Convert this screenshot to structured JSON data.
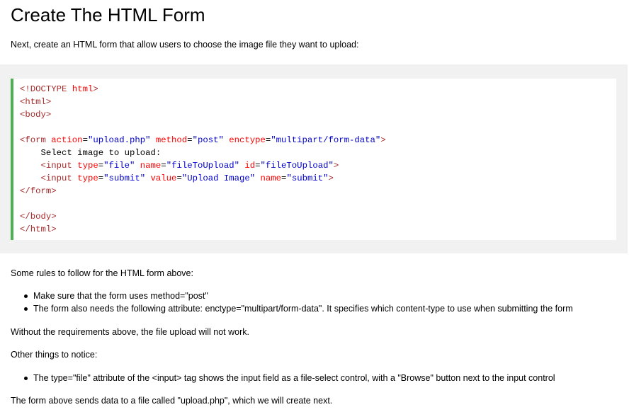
{
  "heading": "Create The HTML Form",
  "intro": "Next, create an HTML form that allow users to choose the image file they want to upload:",
  "code_lines": [
    [
      {
        "t": "<",
        "c": "tag"
      },
      {
        "t": "!DOCTYPE",
        "c": "tag"
      },
      {
        "t": " html",
        "c": "attr"
      },
      {
        "t": ">",
        "c": "tag"
      }
    ],
    [
      {
        "t": "<html>",
        "c": "tag"
      }
    ],
    [
      {
        "t": "<body>",
        "c": "tag"
      }
    ],
    [],
    [
      {
        "t": "<form",
        "c": "tag"
      },
      {
        "t": " action",
        "c": "attr"
      },
      {
        "t": "=",
        "c": "text"
      },
      {
        "t": "\"upload.php\"",
        "c": "val"
      },
      {
        "t": " method",
        "c": "attr"
      },
      {
        "t": "=",
        "c": "text"
      },
      {
        "t": "\"post\"",
        "c": "val"
      },
      {
        "t": " enctype",
        "c": "attr"
      },
      {
        "t": "=",
        "c": "text"
      },
      {
        "t": "\"multipart/form-data\"",
        "c": "val"
      },
      {
        "t": ">",
        "c": "tag"
      }
    ],
    [
      {
        "t": "    Select image to upload:",
        "c": "text"
      }
    ],
    [
      {
        "t": "    ",
        "c": "text"
      },
      {
        "t": "<input",
        "c": "tag"
      },
      {
        "t": " type",
        "c": "attr"
      },
      {
        "t": "=",
        "c": "text"
      },
      {
        "t": "\"file\"",
        "c": "val"
      },
      {
        "t": " name",
        "c": "attr"
      },
      {
        "t": "=",
        "c": "text"
      },
      {
        "t": "\"fileToUpload\"",
        "c": "val"
      },
      {
        "t": " id",
        "c": "attr"
      },
      {
        "t": "=",
        "c": "text"
      },
      {
        "t": "\"fileToUpload\"",
        "c": "val"
      },
      {
        "t": ">",
        "c": "tag"
      }
    ],
    [
      {
        "t": "    ",
        "c": "text"
      },
      {
        "t": "<input",
        "c": "tag"
      },
      {
        "t": " type",
        "c": "attr"
      },
      {
        "t": "=",
        "c": "text"
      },
      {
        "t": "\"submit\"",
        "c": "val"
      },
      {
        "t": " value",
        "c": "attr"
      },
      {
        "t": "=",
        "c": "text"
      },
      {
        "t": "\"Upload Image\"",
        "c": "val"
      },
      {
        "t": " name",
        "c": "attr"
      },
      {
        "t": "=",
        "c": "text"
      },
      {
        "t": "\"submit\"",
        "c": "val"
      },
      {
        "t": ">",
        "c": "tag"
      }
    ],
    [
      {
        "t": "</form>",
        "c": "tag"
      }
    ],
    [],
    [
      {
        "t": "</body>",
        "c": "tag"
      }
    ],
    [
      {
        "t": "</html>",
        "c": "tag"
      }
    ]
  ],
  "rules_intro": "Some rules to follow for the HTML form above:",
  "rules": [
    "Make sure that the form uses method=\"post\"",
    "The form also needs the following attribute: enctype=\"multipart/form-data\". It specifies which content-type to use when submitting the form"
  ],
  "requirement_note": "Without the requirements above, the file upload will not work.",
  "notice_intro": "Other things to notice:",
  "notices": [
    "The type=\"file\" attribute of the <input> tag shows the input field as a file-select control, with a \"Browse\" button next to the input control"
  ],
  "closing": "The form above sends data to a file called \"upload.php\", which we will create next.",
  "colors": {
    "code_border": "#4caf50",
    "code_background_band": "#f1f1f1",
    "tag": "#a52a2a",
    "attribute": "#ff0000",
    "value": "#0000cd"
  }
}
